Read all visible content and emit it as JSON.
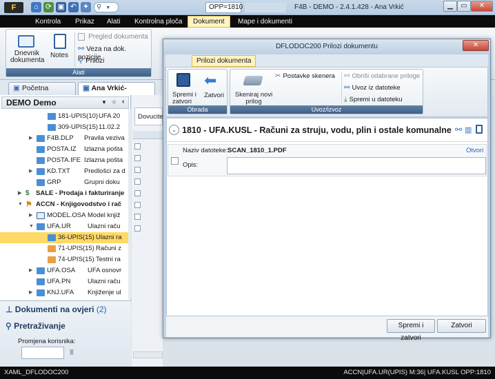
{
  "titlebar": {
    "opp": "OPP=1810",
    "title": "F4B - DEMO - 2.4.1.428 - Ana  Vrkić"
  },
  "menu": [
    "Kontrola",
    "Prikaz",
    "Alati",
    "Kontrolna ploča",
    "Dokument",
    "Mape i dokumenti"
  ],
  "ribbon": {
    "dnevnik": "Dnevnik dokumenta",
    "notes": "Notes",
    "pregled": "Pregled dokumenta",
    "veza": "Veza na dok. pozicije",
    "prilozi": "Prilozi",
    "group_caption": "Alati"
  },
  "tabs": [
    "Početna stranica",
    "Ana Vrkić-Smirčić"
  ],
  "left": {
    "org": "DEMO  Demo",
    "tree": [
      {
        "code": "181-UPIS(10)",
        "desc": "UFA 20"
      },
      {
        "code": "309-UPIS(15)",
        "desc": "11.02.2"
      },
      {
        "code": "F4B.DLP",
        "desc": "Pravila veziva"
      },
      {
        "code": "POSTA.IZ",
        "desc": "Izlazna pošta"
      },
      {
        "code": "POSTA.IFE",
        "desc": "Izlazna pošta"
      },
      {
        "code": "KD.TXT",
        "desc": "Predlošci za d"
      },
      {
        "code": "GRP",
        "desc": "Grupni doku"
      },
      {
        "code": "SALE - Prodaja i fakturiranje",
        "desc": ""
      },
      {
        "code": "ACCN - Knjigovodstvo i rač",
        "desc": ""
      },
      {
        "code": "MODEL.OSA",
        "desc": "Model knjiž"
      },
      {
        "code": "UFA.UR",
        "desc": "Ulazni raču"
      },
      {
        "code": "36-UPIS(15)",
        "desc": "Ulazni ra"
      },
      {
        "code": "71-UPIS(15)",
        "desc": "Računi z"
      },
      {
        "code": "74-UPIS(15)",
        "desc": "Testni ra"
      },
      {
        "code": "UFA.OSA",
        "desc": "UFA osnovr"
      },
      {
        "code": "UFA.PN",
        "desc": "Ulazni raču"
      },
      {
        "code": "KNJ.UFA",
        "desc": "Knjiženje ul"
      }
    ],
    "dokumenti_label": "Dokumenti na ovjeri",
    "dokumenti_count": "(2)",
    "pretrazivanje": "Pretraživanje",
    "promjena": "Promjena korisnika:"
  },
  "grid": {
    "dovucite": "Dovucite"
  },
  "status": {
    "left": "XAML_DFLODOC200",
    "right": "ACCN|UFA.UR(UPIS) M:36| UFA.KUSL OPP:1810"
  },
  "dialog": {
    "title": "DFLODOC200  Prilozi dokumentu",
    "tab": "Prilozi dokumenta",
    "spremi_zatvori": "Spremi i zatvori",
    "zatvori": "Zatvori",
    "obrada": "Obrada",
    "skeniraj": "Skeniraj novi prilog",
    "postavke": "Postavke skenera",
    "obrisi": "Obriši odabrane priloge",
    "uvoz": "Uvoz iz datoteke",
    "spremi_dat": "Spremi u datoteku",
    "uvoz_izvoz": "Uvoz/izvoz",
    "doc_number": "1810",
    "doc_code": "UFA.KUSL",
    "doc_desc": "Računi za struju, vodu, plin i ostale komunalne",
    "naziv_label": "Naziv datoteke:",
    "naziv_value": "SCAN_1810_1.PDF",
    "otvori": "Otvori",
    "opis_label": "Opis:",
    "footer_save": "Spremi i zatvori",
    "footer_close": "Zatvori"
  },
  "colors": {
    "accent": "#ffd966",
    "menu_bg": "#0c0c0c",
    "caption": "#4a6a91",
    "close_red": "#c44a3c"
  }
}
